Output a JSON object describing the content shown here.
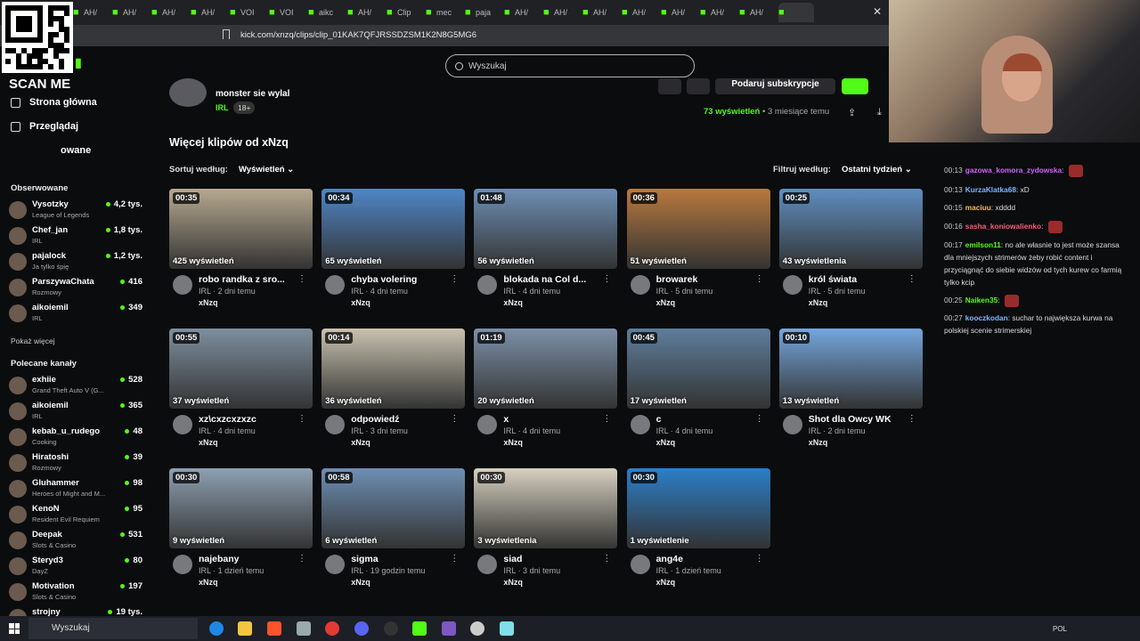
{
  "browser": {
    "tabs": [
      "AH/",
      "AH/",
      "AH/",
      "AH/",
      "VOI",
      "VOI",
      "aikc",
      "AH/",
      "Clip",
      "mec",
      "paja",
      "AH/",
      "AH/",
      "AH/",
      "AH/",
      "AH/",
      "AH/",
      "AH/"
    ],
    "url": "kick.com/xnzq/clips/clip_01KAK7QFJRSSDZSM1K2N8G5MG6"
  },
  "overlay": {
    "scan_label": "SCAN ME"
  },
  "search": {
    "placeholder": "Wyszukaj"
  },
  "nav": {
    "home": "Strona główna",
    "browse": "Przeglądaj",
    "followed_partial": "owane"
  },
  "followed": {
    "title": "Obserwowane",
    "channels": [
      {
        "name": "Vysotzky",
        "category": "League of Legends",
        "viewers": "4,2 tys."
      },
      {
        "name": "Chef_jan",
        "category": "IRL",
        "viewers": "1,8 tys."
      },
      {
        "name": "pajalock",
        "category": "Ja tylko śpię",
        "viewers": "1,2 tys."
      },
      {
        "name": "ParszywaChata",
        "category": "Rozmowy",
        "viewers": "416"
      },
      {
        "name": "aikoiemil",
        "category": "IRL",
        "viewers": "349"
      }
    ],
    "show_more": "Pokaż więcej"
  },
  "recommended": {
    "title": "Polecane kanały",
    "channels": [
      {
        "name": "exhiie",
        "category": "Grand Theft Auto V (G...",
        "viewers": "528"
      },
      {
        "name": "aikoiemil",
        "category": "IRL",
        "viewers": "365"
      },
      {
        "name": "kebab_u_rudego",
        "category": "Cooking",
        "viewers": "48"
      },
      {
        "name": "Hiratoshi",
        "category": "Rozmowy",
        "viewers": "39"
      },
      {
        "name": "Gluhammer",
        "category": "Heroes of Might and M...",
        "viewers": "98"
      },
      {
        "name": "KenoN",
        "category": "Resident Evil Requiem",
        "viewers": "95"
      },
      {
        "name": "Deepak",
        "category": "Slots & Casino",
        "viewers": "531"
      },
      {
        "name": "Steryd3",
        "category": "DayZ",
        "viewers": "80"
      },
      {
        "name": "Motivation",
        "category": "Slots & Casino",
        "viewers": "197"
      },
      {
        "name": "strojny",
        "category": "",
        "viewers": "19 tys."
      }
    ]
  },
  "clip": {
    "title": "monster sie wylal",
    "tag": "IRL",
    "age_tag": "18+",
    "views": "73 wyświetleń",
    "views_sep": "•",
    "age": "3 miesiące temu",
    "subscribe_label": "Podaruj subskrypcje"
  },
  "more": {
    "title": "Więcej klipów od xNzq",
    "sort_label": "Sortuj według:",
    "sort_value": "Wyświetleń",
    "filter_label": "Filtruj według:",
    "filter_value": "Ostatni tydzień"
  },
  "clips": [
    {
      "duration": "00:35",
      "views": "425 wyświetleń",
      "title": "robo randka z sro...",
      "meta": "IRL · 2 dni temu",
      "author": "xNzq",
      "color": "#b7a990"
    },
    {
      "duration": "00:34",
      "views": "65 wyświetleń",
      "title": "chyba volering",
      "meta": "IRL · 4 dni temu",
      "author": "xNzq",
      "color": "#4f86c8"
    },
    {
      "duration": "01:48",
      "views": "56 wyświetleń",
      "title": "blokada na Col d...",
      "meta": "IRL · 4 dni temu",
      "author": "xNzq",
      "color": "#6d8fb5"
    },
    {
      "duration": "00:36",
      "views": "51 wyświetleń",
      "title": "browarek",
      "meta": "IRL · 5 dni temu",
      "author": "xNzq",
      "color": "#b9793e"
    },
    {
      "duration": "00:25",
      "views": "43 wyświetlenia",
      "title": "król świata",
      "meta": "IRL · 5 dni temu",
      "author": "xNzq",
      "color": "#5f8ec1"
    },
    {
      "duration": "00:55",
      "views": "37 wyświetleń",
      "title": "xz\\cxzcxzxzc",
      "meta": "IRL · 4 dni temu",
      "author": "xNzq",
      "color": "#7e8f9e"
    },
    {
      "duration": "00:14",
      "views": "36 wyświetleń",
      "title": "odpowiedź",
      "meta": "IRL · 3 dni temu",
      "author": "xNzq",
      "color": "#c9c2b0"
    },
    {
      "duration": "01:19",
      "views": "20 wyświetleń",
      "title": "x",
      "meta": "IRL · 4 dni temu",
      "author": "xNzq",
      "color": "#7d90a8"
    },
    {
      "duration": "00:45",
      "views": "17 wyświetleń",
      "title": "c",
      "meta": "IRL · 4 dni temu",
      "author": "xNzq",
      "color": "#5e7e9c"
    },
    {
      "duration": "00:10",
      "views": "13 wyświetleń",
      "title": "Shot dla Owcy WK",
      "meta": "IRL · 2 dni temu",
      "author": "xNzq",
      "color": "#74a7de"
    },
    {
      "duration": "00:30",
      "views": "9 wyświetleń",
      "title": "najebany",
      "meta": "IRL · 1 dzień temu",
      "author": "xNzq",
      "color": "#8ea0b2"
    },
    {
      "duration": "00:58",
      "views": "6 wyświetleń",
      "title": "sigma",
      "meta": "IRL · 19 godzin temu",
      "author": "xNzq",
      "color": "#6e8fb4"
    },
    {
      "duration": "00:30",
      "views": "3 wyświetlenia",
      "title": "siad",
      "meta": "IRL · 3 dni temu",
      "author": "xNzq",
      "color": "#d6d0c0"
    },
    {
      "duration": "00:30",
      "views": "1 wyświetlenie",
      "title": "ang4e",
      "meta": "IRL · 1 dzień temu",
      "author": "xNzq",
      "color": "#2c7fc8"
    }
  ],
  "chat": [
    {
      "time": "00:13",
      "user": "gazowa_komora_zydowska",
      "color": "#d460ff",
      "text": "",
      "emote": true
    },
    {
      "time": "00:13",
      "user": "KurzaKlatka68",
      "color": "#7fb6ff",
      "text": "xD",
      "emote": false
    },
    {
      "time": "00:15",
      "user": "maciuu",
      "color": "#f3c14f",
      "text": "xdddd",
      "emote": false
    },
    {
      "time": "00:16",
      "user": "sasha_koniowalienko",
      "color": "#ff5a7a",
      "text": "",
      "emote": true
    },
    {
      "time": "00:17",
      "user": "emilson11",
      "color": "#53fc18",
      "text": "no ale własnie to jest może szansa dla mniejszych strimerów żeby robić content i przyciągnąć do siebie widzów od tych kurew co farmią tylko kcip",
      "emote": false
    },
    {
      "time": "00:25",
      "user": "Naiken35",
      "color": "#53fc18",
      "text": "",
      "emote": true
    },
    {
      "time": "00:27",
      "user": "kooczkodan",
      "color": "#7fb6ff",
      "text": "suchar to największa kurwa na polskiej scenie strimerskiej",
      "emote": false
    }
  ],
  "taskbar": {
    "search": "Wyszukaj",
    "lang": "POL"
  },
  "colors": {
    "accent": "#53fc18",
    "bg": "#0b0c0e"
  }
}
